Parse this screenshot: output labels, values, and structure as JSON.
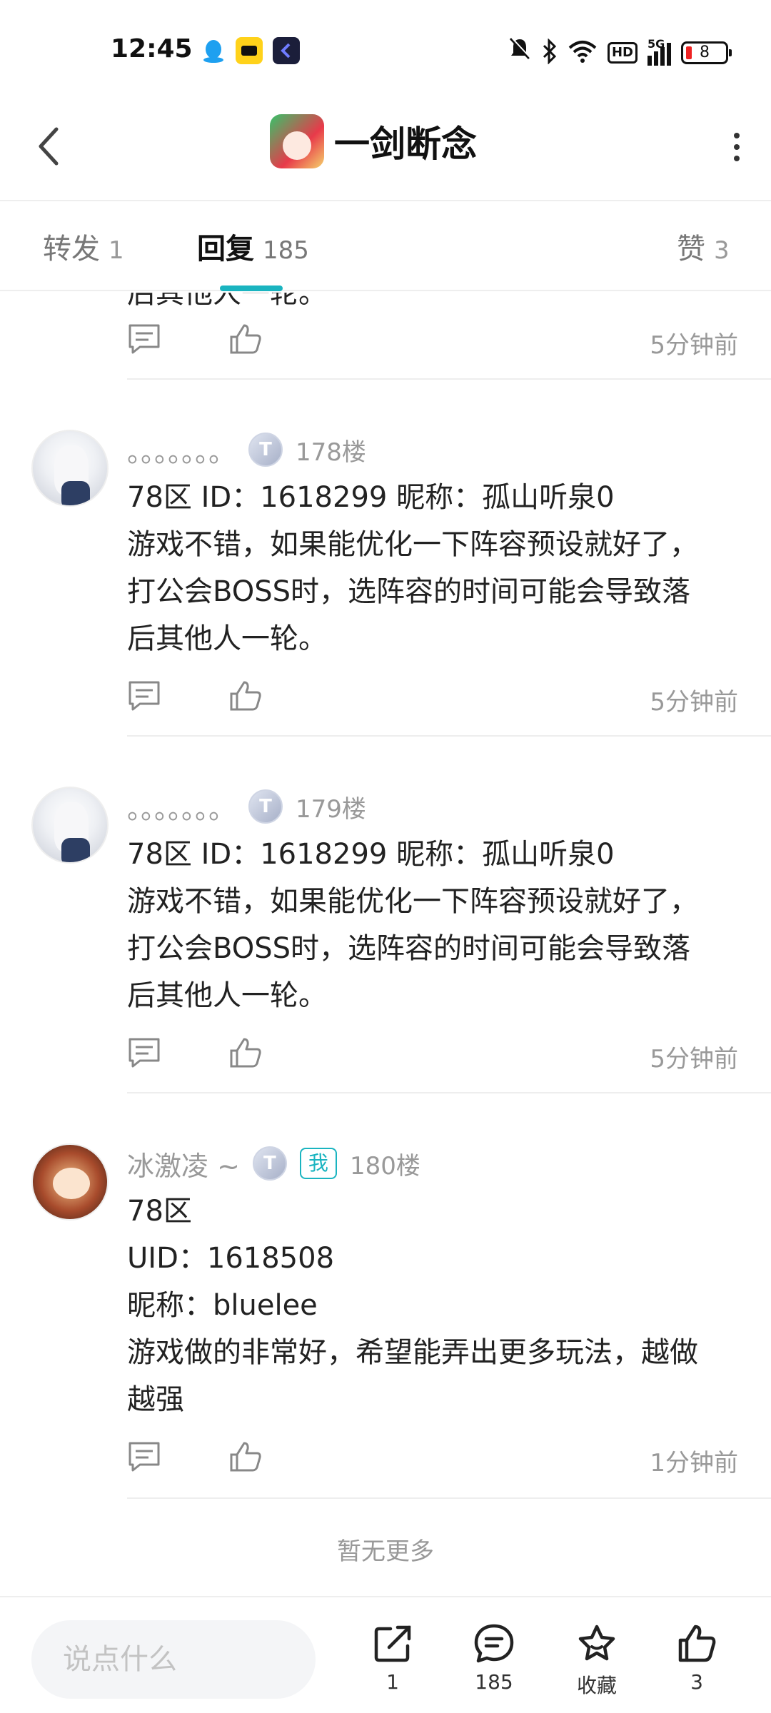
{
  "status_bar": {
    "time": "12:45",
    "app_icons": [
      "qq-icon",
      "kuaishou-icon",
      "app-icon"
    ],
    "hd_label": "HD",
    "network": "5G",
    "battery": "8"
  },
  "header": {
    "title": "一剑断念",
    "back_icon": "chevron-left-icon",
    "more_icon": "more-vertical-icon"
  },
  "tabs": [
    {
      "label": "转发",
      "count": "1"
    },
    {
      "label": "回复",
      "count": "185",
      "active": true
    },
    {
      "label": "赞",
      "count": "3"
    }
  ],
  "accent_color": "#1ab4c0",
  "feed": {
    "partial_text": "后其他人一轮。",
    "partial_time": "5分钟前",
    "comments": [
      {
        "nickname": "。。。。。。。",
        "badge": "T",
        "floor": "178楼",
        "lines": [
          "78区 ID：1618299 昵称：孤山听泉0",
          "游戏不错，如果能优化一下阵容预设就好了，",
          "打公会BOSS时，选阵容的时间可能会导致落",
          "后其他人一轮。"
        ],
        "time": "5分钟前"
      },
      {
        "nickname": "。。。。。。。",
        "badge": "T",
        "floor": "179楼",
        "lines": [
          "78区 ID：1618299 昵称：孤山听泉0",
          "游戏不错，如果能优化一下阵容预设就好了，",
          "打公会BOSS时，选阵容的时间可能会导致落",
          "后其他人一轮。"
        ],
        "time": "5分钟前"
      },
      {
        "nickname": "冰激凌 ~",
        "badge": "T",
        "me_tag": "我",
        "floor": "180楼",
        "lines": [
          "78区",
          "UID：1618508",
          "昵称：bluelee",
          "游戏做的非常好，希望能弄出更多玩法，越做",
          "越强"
        ],
        "time": "1分钟前"
      }
    ],
    "no_more": "暂无更多"
  },
  "bottom_bar": {
    "input_placeholder": "说点什么",
    "share_count": "1",
    "reply_count": "185",
    "favorite_label": "收藏",
    "like_count": "3"
  }
}
